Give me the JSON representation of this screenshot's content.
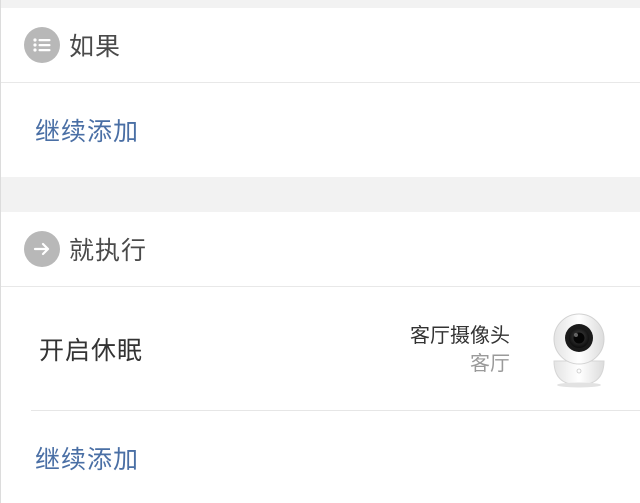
{
  "if_section": {
    "title": "如果",
    "icon": "list-icon",
    "add_label": "继续添加"
  },
  "then_section": {
    "title": "就执行",
    "icon": "arrow-right-icon",
    "actions": [
      {
        "label": "开启休眠",
        "device_name": "客厅摄像头",
        "device_room": "客厅",
        "device_icon": "camera-icon"
      }
    ],
    "add_label": "继续添加"
  }
}
